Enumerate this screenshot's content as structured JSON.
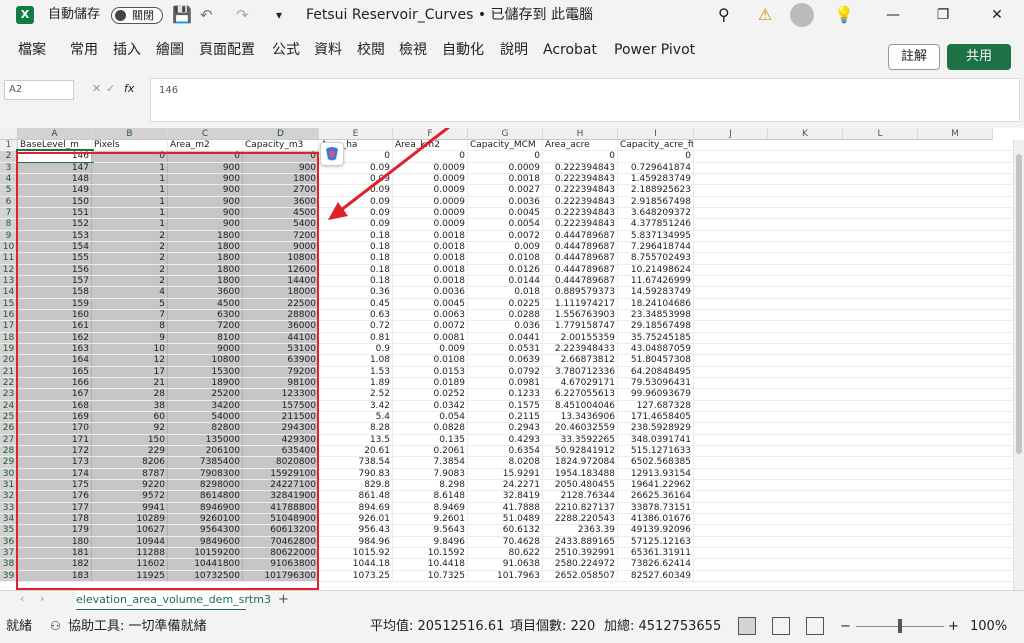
{
  "titlebar": {
    "app_icon": "X",
    "autosave_label": "自動儲存",
    "autosave_state": "關閉",
    "title": "Fetsui Reservoir_Curves • 已儲存到 此電腦",
    "search_icon": "search-icon",
    "warning_icon": "warning-icon",
    "account_icon": "avatar-icon",
    "lightbulb_icon": "lightbulb-icon",
    "min": "—",
    "max": "❐",
    "close": "✕"
  },
  "ribbon": {
    "tabs": [
      "檔案",
      "常用",
      "插入",
      "繪圖",
      "頁面配置",
      "公式",
      "資料",
      "校閱",
      "檢視",
      "自動化",
      "說明",
      "Acrobat",
      "Power Pivot"
    ],
    "comment_label": "註解",
    "share_label": "共用"
  },
  "formula": {
    "name_box": "A2",
    "fx": "fx",
    "value": "146"
  },
  "columns": [
    "A",
    "B",
    "C",
    "D",
    "E",
    "F",
    "G",
    "H",
    "I",
    "J",
    "K",
    "L",
    "M"
  ],
  "headers": [
    "BaseLevel_m",
    "Pixels",
    "Area_m2",
    "Capacity_m3",
    "Area_ha",
    "Area_km2",
    "Capacity_MCM",
    "Area_acre",
    "Capacity_acre_ft"
  ],
  "rows": [
    [
      "146",
      "0",
      "0",
      "0",
      "0",
      "0",
      "0",
      "0",
      "0"
    ],
    [
      "147",
      "1",
      "900",
      "900",
      "0.09",
      "0.0009",
      "0.0009",
      "0.222394843",
      "0.729641874"
    ],
    [
      "148",
      "1",
      "900",
      "1800",
      "0.09",
      "0.0009",
      "0.0018",
      "0.222394843",
      "1.459283749"
    ],
    [
      "149",
      "1",
      "900",
      "2700",
      "0.09",
      "0.0009",
      "0.0027",
      "0.222394843",
      "2.188925623"
    ],
    [
      "150",
      "1",
      "900",
      "3600",
      "0.09",
      "0.0009",
      "0.0036",
      "0.222394843",
      "2.918567498"
    ],
    [
      "151",
      "1",
      "900",
      "4500",
      "0.09",
      "0.0009",
      "0.0045",
      "0.222394843",
      "3.648209372"
    ],
    [
      "152",
      "1",
      "900",
      "5400",
      "0.09",
      "0.0009",
      "0.0054",
      "0.222394843",
      "4.377851246"
    ],
    [
      "153",
      "2",
      "1800",
      "7200",
      "0.18",
      "0.0018",
      "0.0072",
      "0.444789687",
      "5.837134995"
    ],
    [
      "154",
      "2",
      "1800",
      "9000",
      "0.18",
      "0.0018",
      "0.009",
      "0.444789687",
      "7.296418744"
    ],
    [
      "155",
      "2",
      "1800",
      "10800",
      "0.18",
      "0.0018",
      "0.0108",
      "0.444789687",
      "8.755702493"
    ],
    [
      "156",
      "2",
      "1800",
      "12600",
      "0.18",
      "0.0018",
      "0.0126",
      "0.444789687",
      "10.21498624"
    ],
    [
      "157",
      "2",
      "1800",
      "14400",
      "0.18",
      "0.0018",
      "0.0144",
      "0.444789687",
      "11.67426999"
    ],
    [
      "158",
      "4",
      "3600",
      "18000",
      "0.36",
      "0.0036",
      "0.018",
      "0.889579373",
      "14.59283749"
    ],
    [
      "159",
      "5",
      "4500",
      "22500",
      "0.45",
      "0.0045",
      "0.0225",
      "1.111974217",
      "18.24104686"
    ],
    [
      "160",
      "7",
      "6300",
      "28800",
      "0.63",
      "0.0063",
      "0.0288",
      "1.556763903",
      "23.34853998"
    ],
    [
      "161",
      "8",
      "7200",
      "36000",
      "0.72",
      "0.0072",
      "0.036",
      "1.779158747",
      "29.18567498"
    ],
    [
      "162",
      "9",
      "8100",
      "44100",
      "0.81",
      "0.0081",
      "0.0441",
      "2.00155359",
      "35.75245185"
    ],
    [
      "163",
      "10",
      "9000",
      "53100",
      "0.9",
      "0.009",
      "0.0531",
      "2.223948433",
      "43.04887059"
    ],
    [
      "164",
      "12",
      "10800",
      "63900",
      "1.08",
      "0.0108",
      "0.0639",
      "2.66873812",
      "51.80457308"
    ],
    [
      "165",
      "17",
      "15300",
      "79200",
      "1.53",
      "0.0153",
      "0.0792",
      "3.780712336",
      "64.20848495"
    ],
    [
      "166",
      "21",
      "18900",
      "98100",
      "1.89",
      "0.0189",
      "0.0981",
      "4.67029171",
      "79.53096431"
    ],
    [
      "167",
      "28",
      "25200",
      "123300",
      "2.52",
      "0.0252",
      "0.1233",
      "6.227055613",
      "99.96093679"
    ],
    [
      "168",
      "38",
      "34200",
      "157500",
      "3.42",
      "0.0342",
      "0.1575",
      "8.451004046",
      "127.687328"
    ],
    [
      "169",
      "60",
      "54000",
      "211500",
      "5.4",
      "0.054",
      "0.2115",
      "13.3436906",
      "171.4658405"
    ],
    [
      "170",
      "92",
      "82800",
      "294300",
      "8.28",
      "0.0828",
      "0.2943",
      "20.46032559",
      "238.5928929"
    ],
    [
      "171",
      "150",
      "135000",
      "429300",
      "13.5",
      "0.135",
      "0.4293",
      "33.3592265",
      "348.0391741"
    ],
    [
      "172",
      "229",
      "206100",
      "635400",
      "20.61",
      "0.2061",
      "0.6354",
      "50.92841912",
      "515.1271633"
    ],
    [
      "173",
      "8206",
      "7385400",
      "8020800",
      "738.54",
      "7.3854",
      "8.0208",
      "1824.972084",
      "6502.568385"
    ],
    [
      "174",
      "8787",
      "7908300",
      "15929100",
      "790.83",
      "7.9083",
      "15.9291",
      "1954.183488",
      "12913.93154"
    ],
    [
      "175",
      "9220",
      "8298000",
      "24227100",
      "829.8",
      "8.298",
      "24.2271",
      "2050.480455",
      "19641.22962"
    ],
    [
      "176",
      "9572",
      "8614800",
      "32841900",
      "861.48",
      "8.6148",
      "32.8419",
      "2128.76344",
      "26625.36164"
    ],
    [
      "177",
      "9941",
      "8946900",
      "41788800",
      "894.69",
      "8.9469",
      "41.7888",
      "2210.827137",
      "33878.73151"
    ],
    [
      "178",
      "10289",
      "9260100",
      "51048900",
      "926.01",
      "9.2601",
      "51.0489",
      "2288.220543",
      "41386.01676"
    ],
    [
      "179",
      "10627",
      "9564300",
      "60613200",
      "956.43",
      "9.5643",
      "60.6132",
      "2363.39",
      "49139.92096"
    ],
    [
      "180",
      "10944",
      "9849600",
      "70462800",
      "984.96",
      "9.8496",
      "70.4628",
      "2433.889165",
      "57125.12163"
    ],
    [
      "181",
      "11288",
      "10159200",
      "80622000",
      "1015.92",
      "10.1592",
      "80.622",
      "2510.392991",
      "65361.31911"
    ],
    [
      "182",
      "11602",
      "10441800",
      "91063800",
      "1044.18",
      "10.4418",
      "91.0638",
      "2580.224972",
      "73826.62414"
    ],
    [
      "183",
      "11925",
      "10732500",
      "101796300",
      "1073.25",
      "10.7325",
      "101.7963",
      "2652.058507",
      "82527.60349"
    ]
  ],
  "sheet": {
    "tab_name": "elevation_area_volume_dem_srtm3",
    "add": "+"
  },
  "status": {
    "ready": "就緒",
    "accessibility": "協助工具: 一切準備就緒",
    "average": "平均值: 20512516.61",
    "count": "項目個數: 220",
    "sum": "加總: 4512753655",
    "zoom": "100%"
  },
  "accent_colors": {
    "excel_green": "#107c41",
    "annotation_red": "#e0202a",
    "share_green": "#1e7145"
  }
}
